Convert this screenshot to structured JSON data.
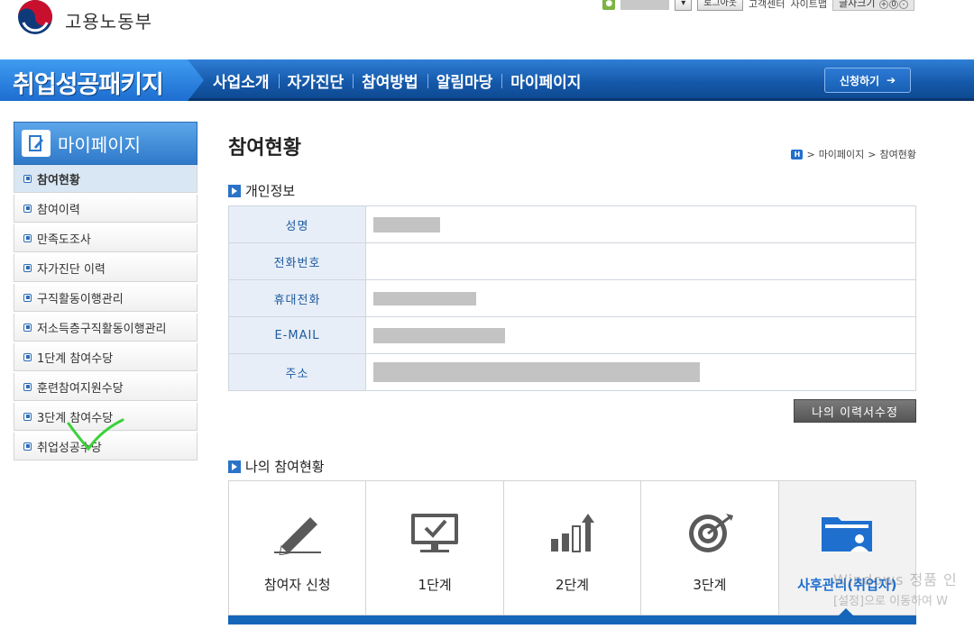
{
  "header": {
    "org_name": "고용노동부",
    "login_label": "로그아웃",
    "util_links": [
      "고객센터",
      "사이트맵"
    ],
    "font_size_label": "글자크기"
  },
  "nav": {
    "brand": "취업성공패키지",
    "menu": [
      "사업소개",
      "자가진단",
      "참여방법",
      "알림마당",
      "마이페이지"
    ],
    "apply_label": "신청하기"
  },
  "sidebar": {
    "title": "마이페이지",
    "items": [
      {
        "label": "참여현황",
        "active": true
      },
      {
        "label": "참여이력"
      },
      {
        "label": "만족도조사"
      },
      {
        "label": "자가진단 이력"
      },
      {
        "label": "구직활동이행관리"
      },
      {
        "label": "저소득층구직활동이행관리"
      },
      {
        "label": "1단계 참여수당"
      },
      {
        "label": "훈련참여지원수당"
      },
      {
        "label": "3단계 참여수당"
      },
      {
        "label": "취업성공수당"
      }
    ]
  },
  "main": {
    "page_title": "참여현황",
    "breadcrumb": [
      "마이페이지",
      "참여현황"
    ],
    "personal_section_title": "개인정보",
    "personal_rows": [
      {
        "label": "성명"
      },
      {
        "label": "전화번호"
      },
      {
        "label": "휴대전화"
      },
      {
        "label": "E-MAIL"
      },
      {
        "label": "주소"
      }
    ],
    "edit_resume_label": "나의 이력서수정",
    "status_section_title": "나의 참여현황",
    "stages": [
      {
        "label": "참여자 신청",
        "icon": "pencil-icon"
      },
      {
        "label": "1단계",
        "icon": "monitor-check-icon"
      },
      {
        "label": "2단계",
        "icon": "bar-growth-icon"
      },
      {
        "label": "3단계",
        "icon": "target-icon"
      },
      {
        "label": "사후관리(취업자)",
        "icon": "folder-user-icon",
        "current": true
      }
    ]
  },
  "overlay": {
    "watermark_line1": "Windows 정품 인",
    "watermark_line2": "[설정]으로 이동하여 W"
  }
}
